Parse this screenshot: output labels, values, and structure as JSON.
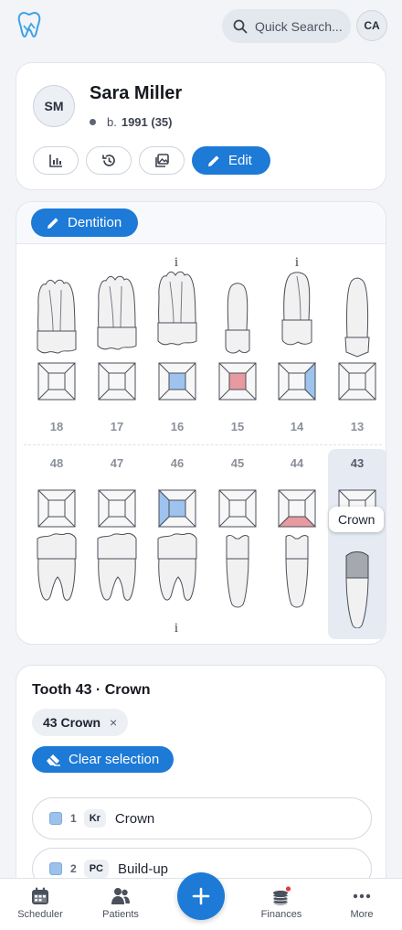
{
  "header": {
    "search_placeholder": "Quick Search...",
    "user_initials": "CA"
  },
  "patient": {
    "initials": "SM",
    "name": "Sara Miller",
    "birth_prefix": "b.",
    "birth_value": "1991 (35)",
    "edit_label": "Edit"
  },
  "dentition": {
    "button_label": "Dentition",
    "info_glyph": "i",
    "upper_numbers": [
      "18",
      "17",
      "16",
      "15",
      "14",
      "13"
    ],
    "lower_numbers": [
      "48",
      "47",
      "46",
      "45",
      "44",
      "43"
    ],
    "selected_tooth": "43",
    "tooltip": "Crown",
    "colors": {
      "blue": "#9ec3ee",
      "red": "#e79aa0",
      "crown": "#a5a8ae"
    }
  },
  "detail": {
    "title": "Tooth 43 · Crown",
    "chip_label": "43 Crown",
    "chip_close": "×",
    "clear_label": "Clear selection",
    "procedures": [
      {
        "num": "1",
        "code": "Kr",
        "name": "Crown"
      },
      {
        "num": "2",
        "code": "PC",
        "name": "Build-up"
      }
    ]
  },
  "nav": {
    "scheduler": "Scheduler",
    "patients": "Patients",
    "finances": "Finances",
    "more": "More"
  }
}
